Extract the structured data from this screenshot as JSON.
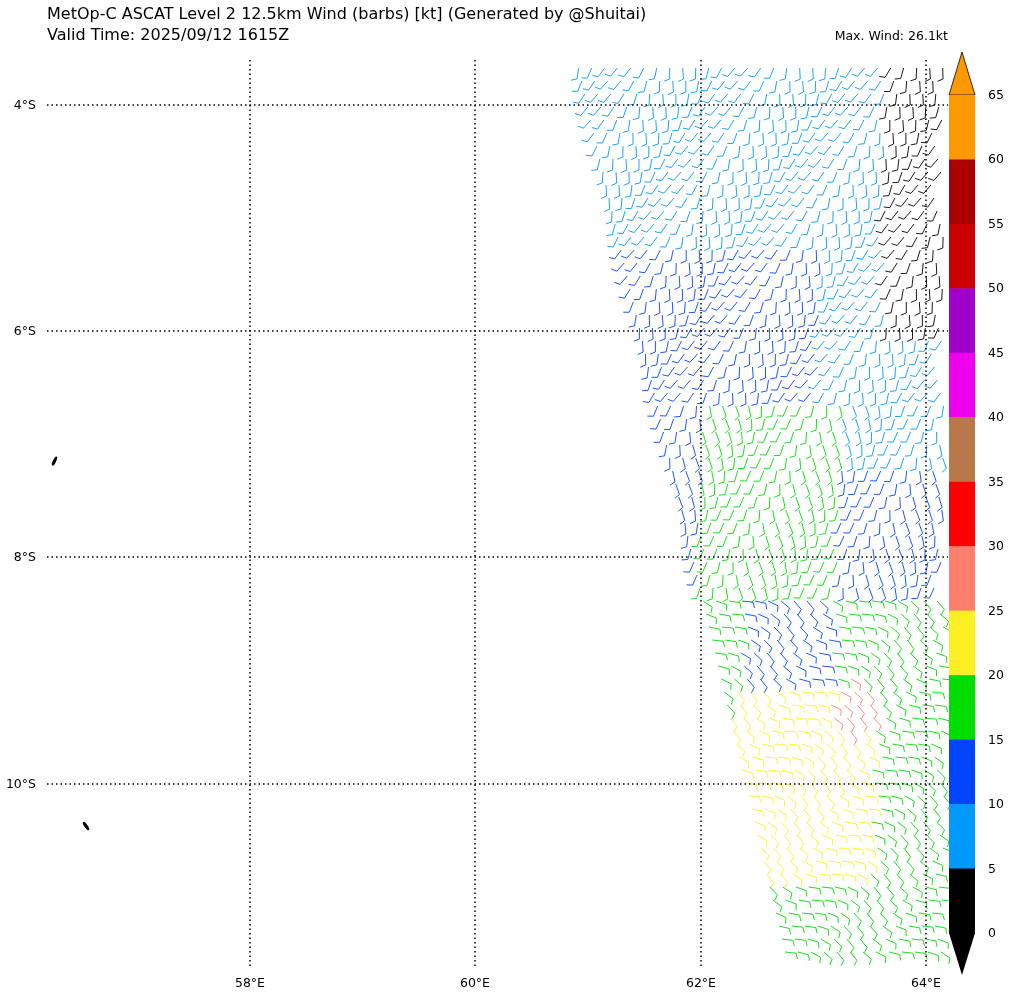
{
  "title": "MetOp-C ASCAT Level 2 12.5km Wind (barbs) [kt] (Generated by @Shuitai)",
  "valid_time": "Valid Time: 2025/09/12 1615Z",
  "max_wind": "Max. Wind: 26.1kt",
  "map": {
    "latitude_labels": [
      "4°S",
      "6°S",
      "8°S",
      "10°S"
    ],
    "longitude_labels": [
      "58°E",
      "60°E",
      "62°E",
      "64°E"
    ]
  },
  "colorbar": {
    "ticks": [
      "65",
      "60",
      "55",
      "50",
      "45",
      "40",
      "35",
      "30",
      "25",
      "20",
      "15",
      "10",
      "5",
      "0"
    ],
    "segments": [
      {
        "color": "#ff9900"
      },
      {
        "color": "#aa0000"
      },
      {
        "color": "#cc0000"
      },
      {
        "color": "#a000c8"
      },
      {
        "color": "#ee00ee"
      },
      {
        "color": "#b8784a"
      },
      {
        "color": "#ff0000"
      },
      {
        "color": "#ff7f6e"
      },
      {
        "color": "#fcf024"
      },
      {
        "color": "#00dd00"
      },
      {
        "color": "#0044ff"
      },
      {
        "color": "#0099ff"
      },
      {
        "color": "#000000"
      }
    ]
  }
}
